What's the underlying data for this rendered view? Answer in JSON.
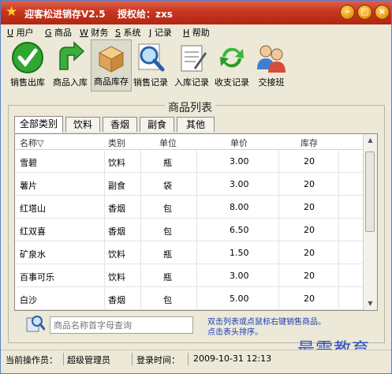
{
  "window": {
    "title": "迎客松进销存V2.5",
    "auth_label": "授权给：zxs",
    "buttons": {
      "minimize": "–",
      "maximize": "□",
      "close": "×"
    }
  },
  "menu": [
    {
      "key": "U",
      "label": "用户"
    },
    {
      "key": "G",
      "label": "商品"
    },
    {
      "key": "W",
      "label": "财务"
    },
    {
      "key": "S",
      "label": "系统"
    },
    {
      "key": "J",
      "label": "记录"
    },
    {
      "key": "H",
      "label": "帮助"
    }
  ],
  "toolbar": [
    {
      "label": "销售出库",
      "icon": "checkmark-icon"
    },
    {
      "label": "商品入库",
      "icon": "green-arrow-icon"
    },
    {
      "label": "商品库存",
      "icon": "box-icon"
    },
    {
      "label": "销售记录",
      "icon": "magnifier-icon"
    },
    {
      "label": "入库记录",
      "icon": "notepad-icon"
    },
    {
      "label": "收支记录",
      "icon": "refresh-icon"
    },
    {
      "label": "交接班",
      "icon": "users-icon"
    }
  ],
  "panel": {
    "title": "商品列表",
    "tabs": [
      "全部类别",
      "饮料",
      "香烟",
      "副食",
      "其他"
    ],
    "columns": [
      "名称▽",
      "类别",
      "单位",
      "单价",
      "库存"
    ],
    "rows": [
      [
        "雪碧",
        "饮料",
        "瓶",
        "3.00",
        "20"
      ],
      [
        "薯片",
        "副食",
        "袋",
        "3.00",
        "20"
      ],
      [
        "红塔山",
        "香烟",
        "包",
        "8.00",
        "20"
      ],
      [
        "红双喜",
        "香烟",
        "包",
        "6.50",
        "20"
      ],
      [
        "矿泉水",
        "饮料",
        "瓶",
        "1.50",
        "20"
      ],
      [
        "百事可乐",
        "饮料",
        "瓶",
        "3.00",
        "20"
      ],
      [
        "白沙",
        "香烟",
        "包",
        "5.00",
        "20"
      ]
    ],
    "search_placeholder": "商品名称首字母查询",
    "hint_line1": "双击列表或点鼠标右键销售商品。",
    "hint_line2": "点击表头排序。"
  },
  "status": {
    "operator_label": "当前操作员：",
    "operator_value": "超级管理员",
    "login_label": "登录时间：",
    "login_value": "2009-10-31 12:13"
  },
  "watermark": "最需教育",
  "colors": {
    "title_bar": "#c8361f",
    "accent_blue": "#1b3db5"
  }
}
